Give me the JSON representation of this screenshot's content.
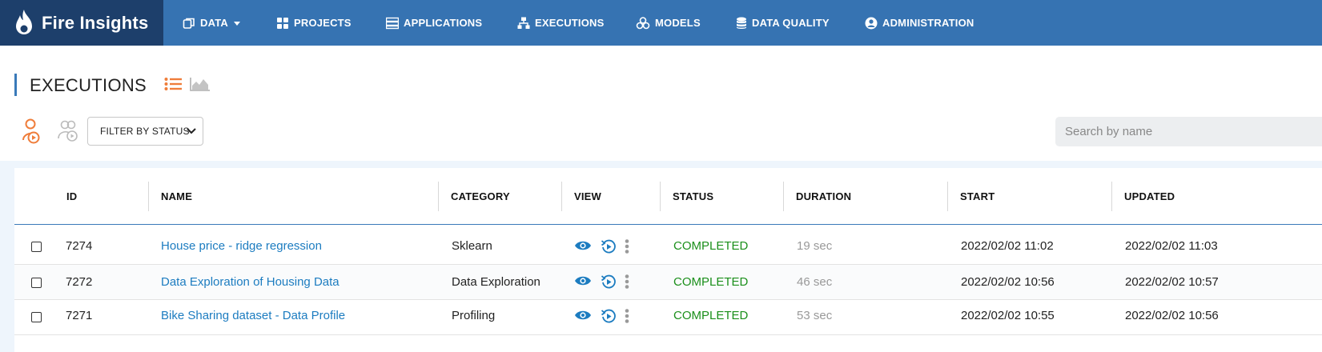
{
  "app": {
    "brand": "Fire Insights",
    "nav": [
      {
        "label": "DATA",
        "icon": "data-icon",
        "dropdown": true
      },
      {
        "label": "PROJECTS",
        "icon": "grid-icon"
      },
      {
        "label": "APPLICATIONS",
        "icon": "server-icon"
      },
      {
        "label": "EXECUTIONS",
        "icon": "sitemap-icon"
      },
      {
        "label": "MODELS",
        "icon": "cubes-icon"
      },
      {
        "label": "DATA QUALITY",
        "icon": "database-icon"
      },
      {
        "label": "ADMINISTRATION",
        "icon": "user-circle-icon"
      }
    ],
    "colors": {
      "nav": "#3673b2",
      "brand_bg": "#1d3f6b",
      "accent": "#ef7d3a",
      "link": "#1c7cc0",
      "completed": "#1b8f1b"
    }
  },
  "page": {
    "title": "EXECUTIONS",
    "filter_label": "FILTER BY STATUS",
    "search_placeholder": "Search by name"
  },
  "table": {
    "columns": [
      "ID",
      "NAME",
      "CATEGORY",
      "VIEW",
      "STATUS",
      "DURATION",
      "START",
      "UPDATED"
    ],
    "rows": [
      {
        "id": "7274",
        "name": "House price - ridge regression",
        "category": "Sklearn",
        "status": "COMPLETED",
        "duration": "19 sec",
        "start": "2022/02/02 11:02",
        "updated": "2022/02/02 11:03"
      },
      {
        "id": "7272",
        "name": "Data Exploration of Housing Data",
        "category": "Data Exploration",
        "status": "COMPLETED",
        "duration": "46 sec",
        "start": "2022/02/02 10:56",
        "updated": "2022/02/02 10:57"
      },
      {
        "id": "7271",
        "name": "Bike Sharing dataset - Data Profile",
        "category": "Profiling",
        "status": "COMPLETED",
        "duration": "53 sec",
        "start": "2022/02/02 10:55",
        "updated": "2022/02/02 10:56"
      }
    ]
  }
}
